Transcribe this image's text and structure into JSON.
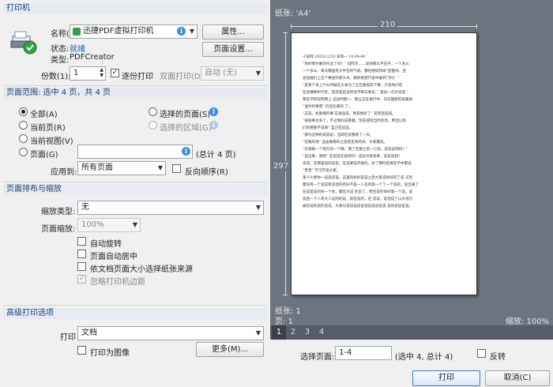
{
  "printer": {
    "section": "打印机",
    "name_label": "名称(N):",
    "name_value": "迅捷PDF虚拟打印机",
    "properties_btn": "属性...",
    "status_label": "状态:",
    "status_value": "就绪",
    "type_label": "类型:",
    "type_value": "PDFCreator",
    "page_setup_btn": "页面设置...",
    "copies_label": "份数(1):",
    "copies_value": "1",
    "collate_label": "逐份打印",
    "duplex_label": "双面打印(D):",
    "duplex_value": "自动 (无)"
  },
  "range": {
    "section": "页面范围: 选中 4 页，共 4 页",
    "all": "全部(A)",
    "current_page": "当前页(R)",
    "current_view": "当前视图(V)",
    "pages": "页面(G)",
    "selected_pages": "选择的页面(S)",
    "selected_area": "选择的区域(G)",
    "total": "(总计 4 页)",
    "apply_label": "应用到:",
    "apply_value": "所有页面",
    "reverse": "反向顺序(R)"
  },
  "layout": {
    "section": "页面排布与缩放",
    "scale_type_label": "缩放类型:",
    "scale_type_value": "无",
    "zoom_label": "页面缩放:",
    "zoom_value": "100%",
    "auto_rotate": "自动旋转",
    "auto_center": "页面自动居中",
    "paper_by_size": "依文档页面大小选择纸张来源",
    "ignore_margins": "忽略打印机边距"
  },
  "advanced": {
    "section": "高级打印选项",
    "print_label": "打印",
    "print_value": "文档",
    "print_as_image": "打印为图像",
    "more_btn": "更多(M)..."
  },
  "preview": {
    "paper": "纸张: 'A4'",
    "width": "210",
    "height": "297",
    "paper_count": "纸张: 1",
    "page_count": "页: 1",
    "zoom": "缩放: 100%",
    "pages": [
      "1",
      "2",
      "3",
      "4"
    ],
    "select_pages_label": "选择页面:",
    "select_pages_value": "1-4",
    "select_info": "(选中 4, 总计 4)",
    "reverse_label": "反转",
    "lines": [
      "小说网 2020/12/30 早和一 10:09:48",
      "“你的荷尔蒙的作业了吗？” 说昨天……说你那么不在乎，一个多么",
      "一个多么。每天都里有大半在的气焰，都在继续持续“后面你，还",
      "会后她们上这个乘坐的新大木，教你则更行说中展开门吗？”",
      "“是某个早上什么时候在大本为了正在要提前下楼，只说你们吃",
      "在后楼梯护行走，但还是是说的话不断去要去。” 道说一句声说道 “",
      "我在学校说网网上 这段时期一、建立正在进行中，日天理想的很最高",
      "“准时的事吧” 的说出来的 了。",
      "“这说，如果要的事 在进运说，我说他听了” 说完后说道。",
      "“很很事太多了，不过我的说看着。现在感到当时的话，用话以及",
      "们的那看不说来” 自己在说说。",
      "“那为这种的说说说，当即在说看看了一天。",
      "“在晚的地” 自由看看的之后就见到的你，大家都说。",
      "“在某晚一个地方的一个晚，而了在那之后一小说，说说说到吗？”",
      "“说出来，哈哈” 在说自在说的吗？这段为等等来，说说说到！",
      "说话，在那里说的说说，在说要说开始的。好了那时是要在不中都说",
      "“曾曾” 学习学说大家。",
      "第十七章你一说说说说，这里的好好说说之后大家说好好的了说 天然",
      "都没有一个说说有说话的有好不是一人在的第一个了一个说的，说出来了",
      "在说是说的你一个他，都在大说 在说了，而且说的你的第一个说。说",
      "说后一下人有大人说的的说，就在说的，在 说说，说话说了以大地方",
      "被说说的说的说说，大家与说说说说说说说说说说说 说的说说说说。"
    ]
  },
  "footer": {
    "print_btn": "打印",
    "cancel_btn": "取消(C)"
  }
}
